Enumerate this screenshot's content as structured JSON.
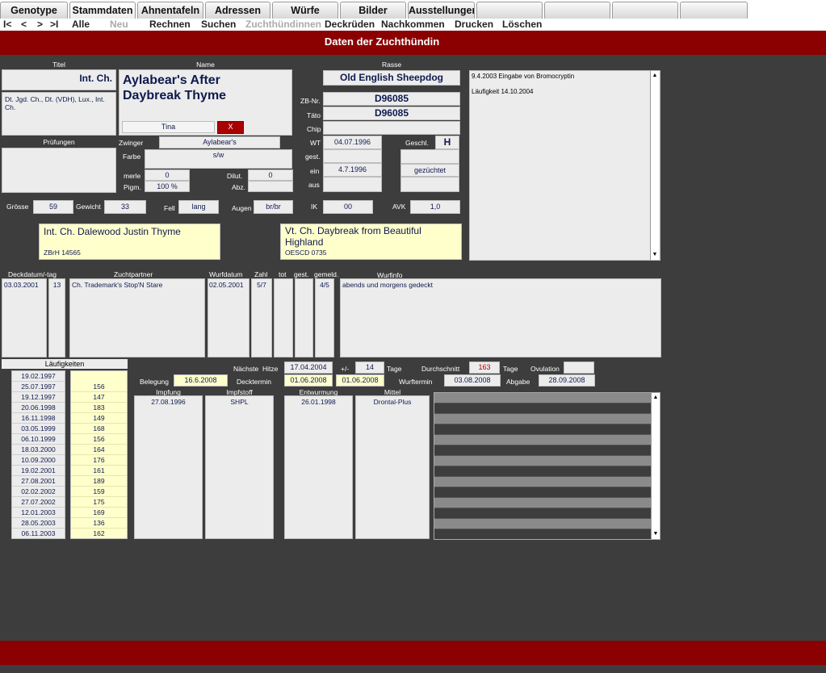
{
  "tabs": [
    "Genotype",
    "Stammdaten",
    "Ahnentafeln",
    "Adressen",
    "Würfe",
    "Bilder",
    "Ausstellungen",
    "",
    "",
    "",
    ""
  ],
  "nav": {
    "first": "I<",
    "prev": "<",
    "next": ">",
    "last": ">I",
    "all": "Alle",
    "new": "Neu",
    "calc": "Rechnen",
    "search": "Suchen",
    "breeding_bitches": "Zuchthündinnen",
    "stud_dogs": "Deckrüden",
    "offspring": "Nachkommen",
    "print": "Drucken",
    "delete": "Löschen"
  },
  "header": {
    "title": "Daten der Zuchthündin"
  },
  "labels": {
    "titel": "Titel",
    "name": "Name",
    "rasse": "Rasse",
    "pruefungen": "Prüfungen",
    "zwinger": "Zwinger",
    "farbe": "Farbe",
    "merle": "merle",
    "pigm": "Pigm.",
    "dilut": "Dilut.",
    "abz": "Abz.",
    "zbnr": "ZB-Nr.",
    "taeto": "Täto",
    "chip": "Chip",
    "wt": "WT",
    "gest": "gest.",
    "ein": "ein",
    "aus": "aus",
    "geschl": "Geschl.",
    "groesse": "Grösse",
    "gewicht": "Gewicht",
    "fell": "Fell",
    "augen": "Augen",
    "ik": "IK",
    "avk": "AVK",
    "deckdatum": "Deckdatum/-tag",
    "zuchtpartner": "Zuchtpartner",
    "wurfdatum": "Wurfdatum",
    "zahl": "Zahl",
    "tot": "tot",
    "gest2": "gest.",
    "gemeld": "gemeld.",
    "wurfinfo": "Wurfinfo",
    "laeufigkeiten": "Läufigkeiten",
    "naechste": "Nächste",
    "hitze": "Hitze",
    "plusminus": "+/-",
    "tage": "Tage",
    "durchschnitt": "Durchschnitt",
    "tage2": "Tage",
    "ovulation": "Ovulation",
    "belegung": "Belegung",
    "decktermin": "Decktermin",
    "wurftermin": "Wurftermin",
    "abgabe": "Abgabe",
    "impfung": "Impfung",
    "impfstoff": "Impfstoff",
    "entwurmung": "Entwurmung",
    "mittel": "Mittel"
  },
  "dog": {
    "titel": "Int. Ch.",
    "titles_full": "Dt. Jgd. Ch., Dt. (VDH), Lux., Int. Ch.",
    "name": "Aylabear's After Daybreak Thyme",
    "callname": "Tina",
    "x_button": "X",
    "rasse": "Old English Sheepdog",
    "zwinger": "Aylabear's",
    "farbe": "s/w",
    "merle": "0",
    "pigm": "100 %",
    "dilut": "0",
    "zbnr": "D96085",
    "taeto": "D96085",
    "wt": "04.07.1996",
    "geschl": "H",
    "ein": "4.7.1996",
    "status": "gezüchtet",
    "groesse": "59",
    "gewicht": "33",
    "fell": "lang",
    "augen": "br/br",
    "ik": "00",
    "avk": "1,0"
  },
  "notes": {
    "line1": "9.4.2003  Eingabe von Bromocryptin",
    "line2": "Läufigkeit   14.10.2004"
  },
  "sire": {
    "name": "Int. Ch. Dalewood Justin Thyme",
    "reg": "ZBrH 14565"
  },
  "dam": {
    "name": "Vt. Ch. Daybreak from Beautiful Highland",
    "reg": "OESCD 0735"
  },
  "litter": {
    "deckdatum": "03.03.2001",
    "tag": "13",
    "partner": "Ch. Trademark's Stop'N Stare",
    "wurfdatum": "02.05.2001",
    "zahl": "5/7",
    "tot": "",
    "gest": "",
    "gemeld": "4/5",
    "info": "abends und morgens gedeckt"
  },
  "heats": {
    "dates": [
      "19.02.1997",
      "25.07.1997",
      "19.12.1997",
      "20.06.1998",
      "16.11.1998",
      "03.05.1999",
      "06.10.1999",
      "18.03.2000",
      "10.09.2000",
      "19.02.2001",
      "27.08.2001",
      "02.02.2002",
      "27.07.2002",
      "12.01.2003",
      "28.05.2003",
      "06.11.2003"
    ],
    "intervals": [
      "156",
      "147",
      "183",
      "149",
      "168",
      "156",
      "164",
      "176",
      "161",
      "189",
      "159",
      "175",
      "169",
      "136",
      "162"
    ]
  },
  "cycle": {
    "hitze": "17.04.2004",
    "plusminus": "14",
    "durchschnitt": "163",
    "ovulation": "",
    "belegung": "16.6.2008",
    "decktermin1": "01.06.2008",
    "decktermin2": "01.06.2008",
    "wurftermin": "03.08.2008",
    "abgabe": "28.09.2008"
  },
  "health": {
    "impfung": "27.08.1996",
    "impfstoff": "SHPL",
    "entwurmung": "26.01.1998",
    "mittel": "Drontal-Plus"
  }
}
